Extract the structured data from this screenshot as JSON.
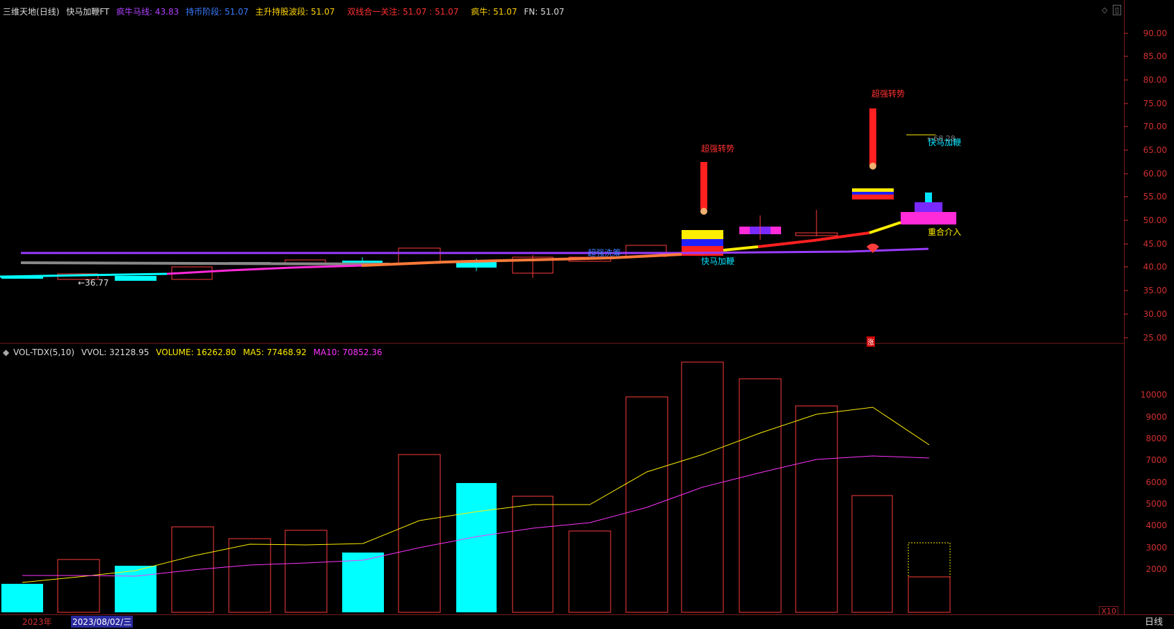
{
  "header": {
    "stock_name": "三维天地",
    "period": "(日线)",
    "indicator": "快马加鞭FT",
    "items": [
      {
        "label": "疯牛马线: 43.83",
        "color": "#b040ff"
      },
      {
        "label": "持币阶段: 51.07",
        "color": "#3a7bff"
      },
      {
        "label": "主升持股波段: 51.07",
        "color": "#ffd400"
      },
      {
        "label": "双线合一关注: 51.07 : 51.07",
        "color": "#ff3030"
      },
      {
        "label": "疯牛: 51.07",
        "color": "#ffd400"
      },
      {
        "label": "FN: 51.07",
        "color": "#dddddd"
      }
    ]
  },
  "price_axis": [
    "90.00",
    "85.00",
    "80.00",
    "75.00",
    "70.00",
    "65.00",
    "60.00",
    "55.00",
    "50.00",
    "45.00",
    "40.00",
    "35.00",
    "30.00",
    "25.00"
  ],
  "volume_axis": [
    "10000",
    "9000",
    "8000",
    "7000",
    "6000",
    "5000",
    "4000",
    "3000",
    "2000"
  ],
  "annotations": {
    "super_trend_1": "超强转势",
    "super_trend_2": "超强转势",
    "super_wash": "超强洗筹",
    "fast_horse_1": "快马加鞭",
    "fast_horse_2": "快马加鞭",
    "overlap_entry": "重合介入",
    "low_marker": "←36.77",
    "price_marker": "←68.28",
    "zhang": "涨"
  },
  "volume_header": {
    "name": "VOL-TDX(5,10)",
    "vvol": "VVOL: 32128.95",
    "volume": "VOLUME: 16262.80",
    "ma5": "MA5: 77468.92",
    "ma10": "MA10: 70852.36"
  },
  "bottom": {
    "year": "2023年",
    "date": "2023/08/02/三",
    "period_button": "日线",
    "scale": "X10"
  },
  "colors": {
    "up": "#ff3c3c",
    "down": "#00ffff",
    "axis": "#d03030",
    "ma5": "#ffff33",
    "ma10": "#ff33ff"
  }
}
